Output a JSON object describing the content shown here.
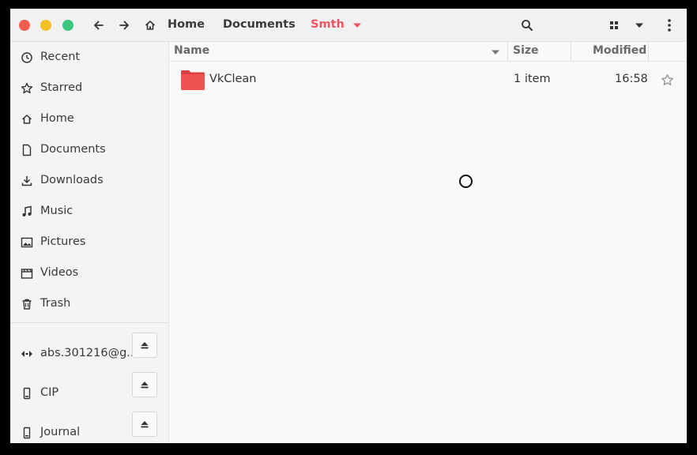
{
  "header": {
    "breadcrumbs": [
      {
        "label": "Home"
      },
      {
        "label": "Documents"
      },
      {
        "label": "Smth"
      }
    ]
  },
  "sidebar": {
    "places": [
      {
        "label": "Recent",
        "icon": "clock-icon"
      },
      {
        "label": "Starred",
        "icon": "star-icon"
      },
      {
        "label": "Home",
        "icon": "home-icon"
      },
      {
        "label": "Documents",
        "icon": "document-icon"
      },
      {
        "label": "Downloads",
        "icon": "download-icon"
      },
      {
        "label": "Music",
        "icon": "music-icon"
      },
      {
        "label": "Pictures",
        "icon": "picture-icon"
      },
      {
        "label": "Videos",
        "icon": "video-icon"
      },
      {
        "label": "Trash",
        "icon": "trash-icon"
      }
    ],
    "devices": [
      {
        "label": "abs.301216@g...",
        "icon": "network-icon"
      },
      {
        "label": "CIP",
        "icon": "drive-icon"
      },
      {
        "label": "Journal",
        "icon": "drive-icon"
      }
    ]
  },
  "columns": {
    "name": "Name",
    "size": "Size",
    "modified": "Modified"
  },
  "files": [
    {
      "name": "VkClean",
      "size": "1 item",
      "modified": "16:58",
      "icon": "folder-icon"
    }
  ],
  "colors": {
    "accent": "#ee5563",
    "folder": "#e94b4b"
  }
}
